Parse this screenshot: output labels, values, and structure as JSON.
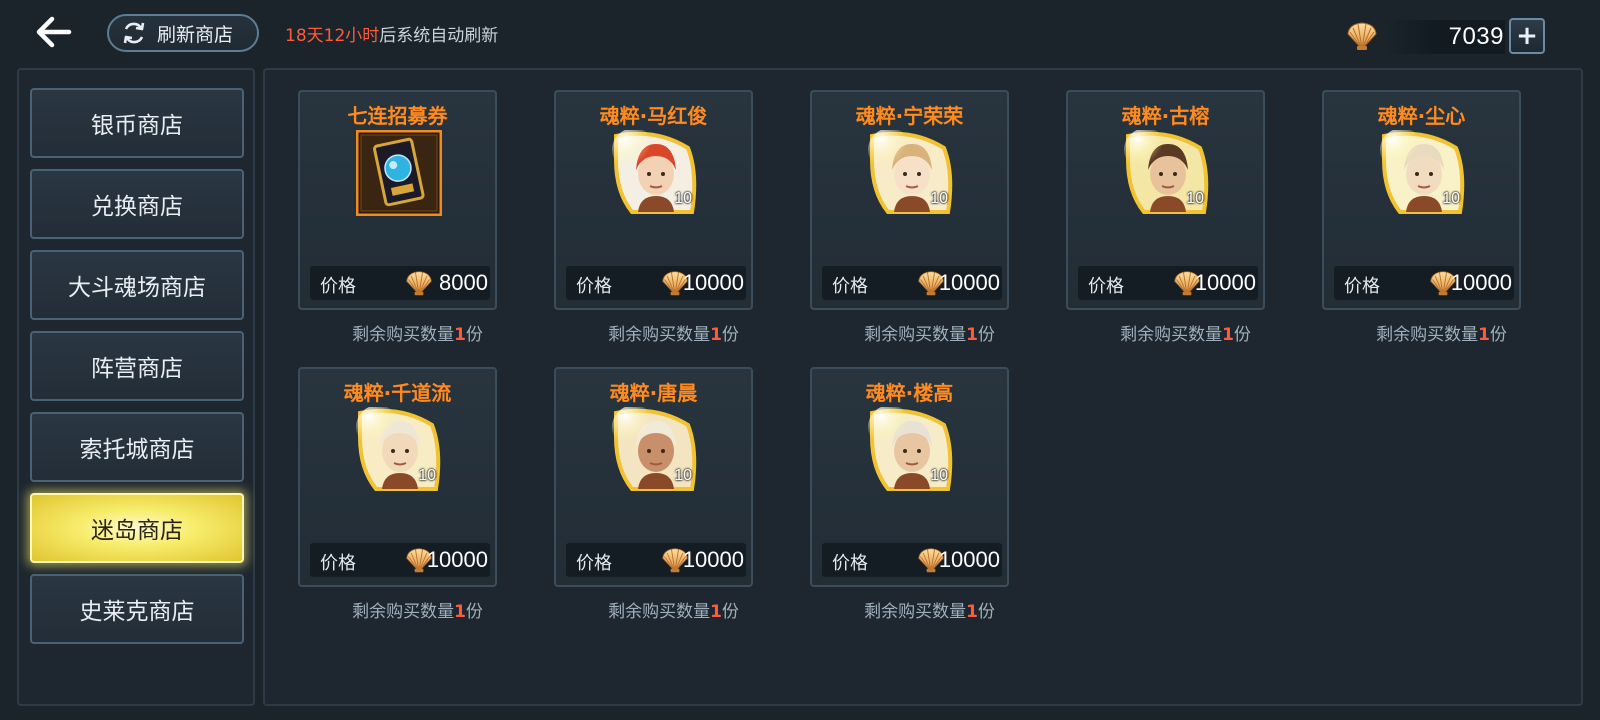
{
  "header": {
    "refresh_button_label": "刷新商店",
    "refresh_info_highlight": "18天12小时",
    "refresh_info_suffix": "后系统自动刷新",
    "currency_amount": "7039",
    "add_currency_symbol": "+",
    "currency_icon": "shell-icon"
  },
  "sidebar": {
    "items": [
      {
        "label": "银币商店",
        "active": false
      },
      {
        "label": "兑换商店",
        "active": false
      },
      {
        "label": "大斗魂场商店",
        "active": false
      },
      {
        "label": "阵营商店",
        "active": false
      },
      {
        "label": "索托城商店",
        "active": false
      },
      {
        "label": "迷岛商店",
        "active": true
      },
      {
        "label": "史莱克商店",
        "active": false
      }
    ]
  },
  "shop": {
    "price_label": "价格",
    "remain_prefix": "剩余购买数量",
    "remain_suffix": "份",
    "items": [
      {
        "title": "七连招募券",
        "price": "8000",
        "remain": "1",
        "icon": "recruit-ticket-icon",
        "count": ""
      },
      {
        "title": "魂粹·马红俊",
        "price": "10000",
        "remain": "1",
        "icon": "hero-portrait-ma-hongjun",
        "count": "10"
      },
      {
        "title": "魂粹·宁荣荣",
        "price": "10000",
        "remain": "1",
        "icon": "hero-portrait-ning-rongrong",
        "count": "10"
      },
      {
        "title": "魂粹·古榕",
        "price": "10000",
        "remain": "1",
        "icon": "hero-portrait-gu-rong",
        "count": "10"
      },
      {
        "title": "魂粹·尘心",
        "price": "10000",
        "remain": "1",
        "icon": "hero-portrait-chen-xin",
        "count": "10"
      },
      {
        "title": "魂粹·千道流",
        "price": "10000",
        "remain": "1",
        "icon": "hero-portrait-qian-daoliu",
        "count": "10"
      },
      {
        "title": "魂粹·唐晨",
        "price": "10000",
        "remain": "1",
        "icon": "hero-portrait-tang-chen",
        "count": "10"
      },
      {
        "title": "魂粹·楼高",
        "price": "10000",
        "remain": "1",
        "icon": "hero-portrait-lou-gao",
        "count": "10"
      }
    ]
  },
  "colors": {
    "accent_orange": "#ff8a1e",
    "highlight_red": "#ff5c3a",
    "active_tab_yellow": "#f7ec6a",
    "background": "#1b232b"
  }
}
